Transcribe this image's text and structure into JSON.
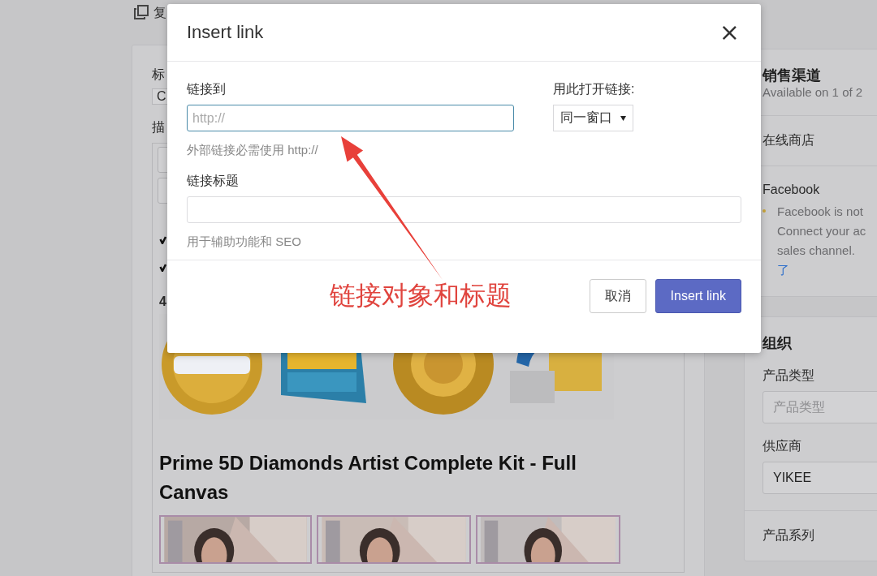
{
  "toolbar": {
    "action_label": "复"
  },
  "product_form": {
    "title_label": "标",
    "title_value": "C",
    "description_label": "描",
    "list_marker": "4",
    "product_heading": "Prime 5D Diamonds Artist Complete Kit - Full Canvas"
  },
  "sales_channels": {
    "heading": "销售渠道",
    "summary": "Available on 1 of 2",
    "channels": [
      {
        "name": "在线商店"
      },
      {
        "name": "Facebook",
        "notice_lines": [
          "Facebook is not",
          "Connect your ac",
          "sales channel."
        ],
        "link": "了"
      }
    ]
  },
  "organization": {
    "heading": "组织",
    "fields": [
      {
        "label": "产品类型",
        "placeholder": "产品类型"
      },
      {
        "label": "供应商",
        "value": "YIKEE"
      }
    ],
    "next_label": "产品系列"
  },
  "modal": {
    "title": "Insert link",
    "close": "×",
    "url_label": "链接到",
    "url_placeholder": "http://",
    "url_hint": "外部链接必需使用 http://",
    "target_label": "用此打开链接:",
    "target_value": "同一窗口",
    "caption_label": "链接标题",
    "caption_hint": "用于辅助功能和 SEO",
    "cancel": "取消",
    "submit": "Insert link",
    "annotation": "链接对象和标题"
  }
}
